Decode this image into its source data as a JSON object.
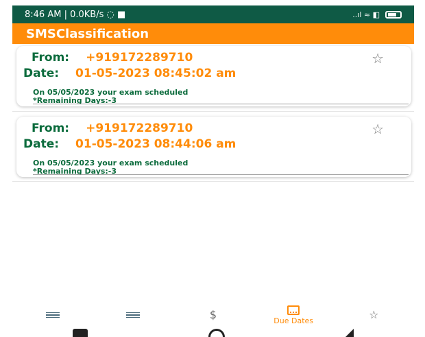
{
  "status_bar": {
    "left_text": "8:46 AM | 0.0KB/s ◌ ■",
    "right_text": "..ıl ≈ ◧"
  },
  "app_bar": {
    "title": "SMSClassification"
  },
  "messages": [
    {
      "from_label": "From:",
      "from_value": "+919172289710",
      "date_label": "Date:",
      "date_value": "01-05-2023 08:45:02 am",
      "body_line_1": "On 05/05/2023 your exam scheduled",
      "body_line_2": "*Remaining Days:-3",
      "star": "☆"
    },
    {
      "from_label": "From:",
      "from_value": "+919172289710",
      "date_label": "Date:",
      "date_value": "01-05-2023 08:44:06 am",
      "body_line_1": "On 05/05/2023 your exam scheduled",
      "body_line_2": "*Remaining Days:-3",
      "star": "☆"
    }
  ],
  "bottom_nav": {
    "active_item": "due-dates",
    "items": [
      {
        "id": "list-1",
        "icon": "list-icon",
        "label": ""
      },
      {
        "id": "list-2",
        "icon": "list-icon",
        "label": ""
      },
      {
        "id": "dollar",
        "icon": "dollar-icon",
        "label": "",
        "glyph": "$"
      },
      {
        "id": "due-dates",
        "icon": "calendar-icon",
        "label": "Due Dates"
      },
      {
        "id": "star",
        "icon": "star-icon",
        "label": "",
        "glyph": "☆"
      }
    ]
  },
  "colors": {
    "status_bar": "#0f5a45",
    "accent": "#ff8c0a",
    "label_green": "#0b6b3c"
  }
}
